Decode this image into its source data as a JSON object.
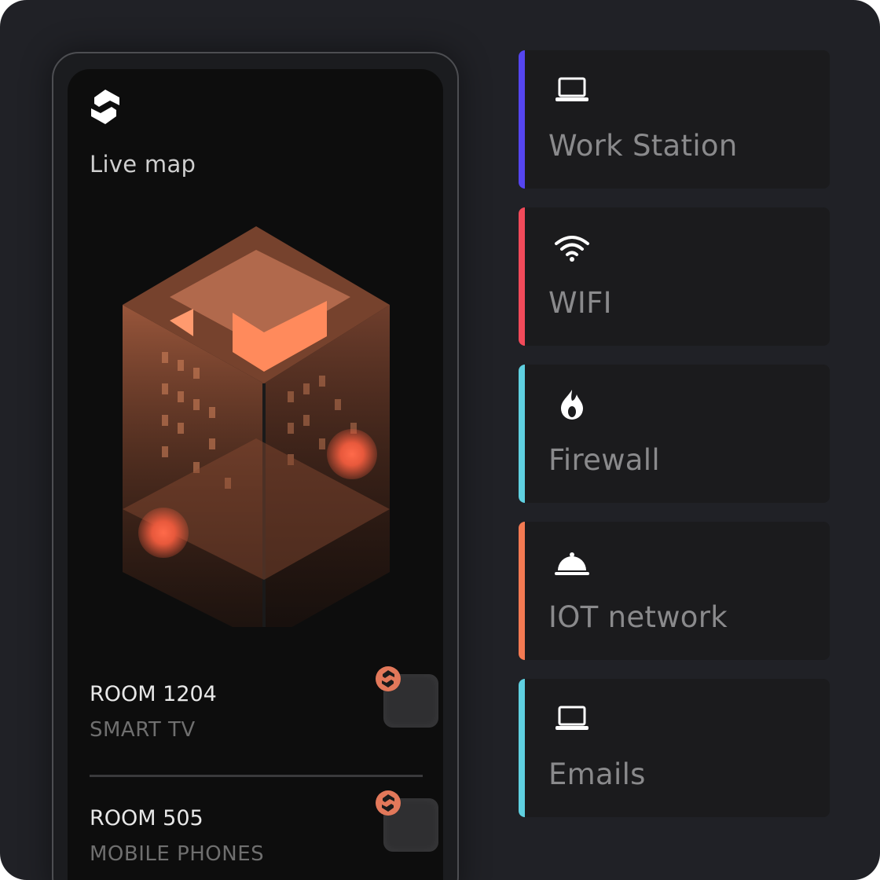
{
  "phone": {
    "title": "Live map",
    "rooms": [
      {
        "name": "ROOM 1204",
        "device": "SMART TV"
      },
      {
        "name": "ROOM 505",
        "device": "MOBILE PHONES"
      }
    ]
  },
  "cards": [
    {
      "label": "Work Station",
      "icon": "laptop-icon",
      "accent": "#5545f0"
    },
    {
      "label": "WIFI",
      "icon": "wifi-icon",
      "accent": "#f24a5a"
    },
    {
      "label": "Firewall",
      "icon": "flame-icon",
      "accent": "#5fd0e0"
    },
    {
      "label": "IOT network",
      "icon": "service-bell-icon",
      "accent": "#f47a52"
    },
    {
      "label": "Emails",
      "icon": "laptop-icon",
      "accent": "#5fd0e0"
    }
  ],
  "colors": {
    "background": "#202126",
    "screen": "#0d0d0d",
    "building": "#c0704e",
    "badge": "#e2785a"
  }
}
